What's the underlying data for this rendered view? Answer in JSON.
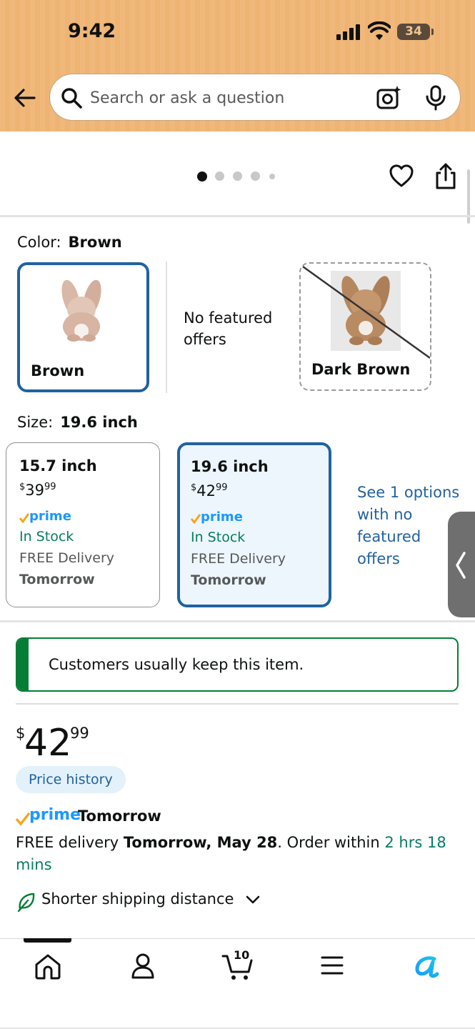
{
  "status_bar": {
    "time": "9:42",
    "battery": "34"
  },
  "search": {
    "placeholder": "Search or ask a question"
  },
  "carousel": {
    "dot_count": 5,
    "active_dot": 0
  },
  "color": {
    "label": "Color:",
    "selected": "Brown",
    "options": [
      {
        "name": "Brown",
        "state": "selected"
      },
      {
        "name": "Dark Brown",
        "state": "unavailable"
      }
    ],
    "no_offers_text": "No featured offers"
  },
  "size": {
    "label": "Size:",
    "selected": "19.6 inch",
    "options": [
      {
        "name": "15.7 inch",
        "price_dollars": "39",
        "price_cents": "99",
        "prime": "prime",
        "stock": "In Stock",
        "delivery": "FREE Delivery",
        "when": "Tomorrow"
      },
      {
        "name": "19.6 inch",
        "price_dollars": "42",
        "price_cents": "99",
        "prime": "prime",
        "stock": "In Stock",
        "delivery": "FREE Delivery",
        "when": "Tomorrow"
      }
    ],
    "see_options": "See 1 options with no featured offers"
  },
  "banner": {
    "text": "Customers usually keep this item."
  },
  "price": {
    "currency": "$",
    "whole": "42",
    "fraction": "99",
    "history_button": "Price history"
  },
  "prime_delivery": {
    "prime_label": "prime",
    "prime_when": "Tomorrow",
    "free_delivery_prefix": "FREE delivery ",
    "date": "Tomorrow, May 28",
    "order_within_prefix": ". Order within ",
    "countdown": "2 hrs 18 mins"
  },
  "shipping": {
    "label": "Shorter shipping distance"
  },
  "nav": {
    "cart_count": "10",
    "active_tab": "home"
  },
  "colors": {
    "link": "#2162a1",
    "green": "#067d62",
    "keep_green": "#067d35",
    "prime_blue": "#1a98ff",
    "prime_check": "#f7a41d",
    "header": "#f0b87a"
  }
}
